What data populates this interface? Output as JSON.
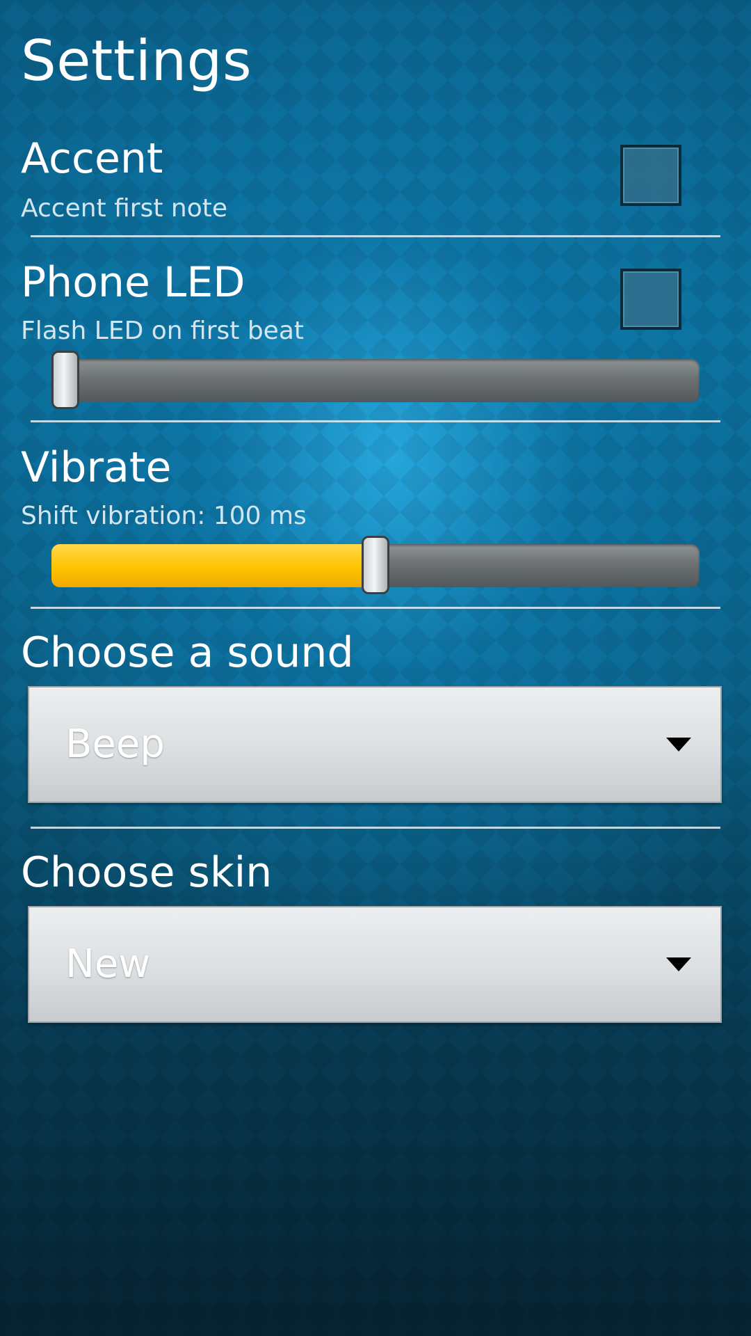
{
  "page": {
    "title": "Settings"
  },
  "accent": {
    "title": "Accent",
    "summary": "Accent first note",
    "checked": false
  },
  "phone_led": {
    "title": "Phone LED",
    "summary": "Flash LED on first beat",
    "checked": false,
    "slider_fraction": 0.02
  },
  "vibrate": {
    "title": "Vibrate",
    "summary": "Shift vibration: 100 ms",
    "slider_fraction": 0.5
  },
  "sound": {
    "title": "Choose a sound",
    "selected": "Beep"
  },
  "skin": {
    "title": "Choose skin",
    "selected": "New"
  },
  "colors": {
    "slider_fill": "#ffc400",
    "background": "#0b6f9b"
  }
}
